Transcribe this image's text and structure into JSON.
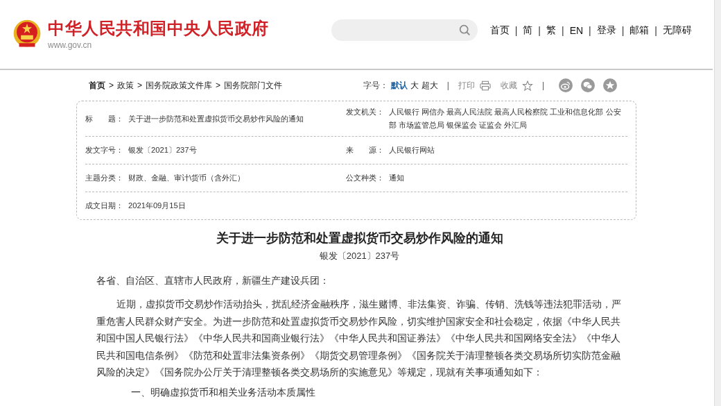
{
  "header": {
    "site_title": "中华人民共和国中央人民政府",
    "site_url": "www.gov.cn",
    "nav_separator": "|",
    "nav_links": [
      "首页",
      "简",
      "繁",
      "EN",
      "登录",
      "邮箱",
      "无障碍"
    ]
  },
  "toolbar": {
    "breadcrumb_separator": ">",
    "breadcrumb": [
      {
        "label": "首页",
        "current_root": true
      },
      {
        "label": "政策",
        "current_root": false
      },
      {
        "label": "国务院政策文件库",
        "current_root": false
      },
      {
        "label": "国务院部门文件",
        "current_root": false
      }
    ],
    "font_size_label": "字号：",
    "font_sizes": [
      {
        "label": "默认",
        "selected": true
      },
      {
        "label": "大",
        "selected": false
      },
      {
        "label": "超大",
        "selected": false
      }
    ],
    "separator": "|",
    "print": "打印",
    "favorite": "收藏"
  },
  "info_rows": [
    [
      {
        "label": "标　　题：",
        "value": "关于进一步防范和处置虚拟货币交易炒作风险的通知"
      },
      {
        "label": "发文机关：",
        "value": "人民银行 网信办 最高人民法院 最高人民检察院 工业和信息化部 公安部 市场监管总局 银保监会 证监会 外汇局"
      }
    ],
    [
      {
        "label": "发文字号：",
        "value": "银发〔2021〕237号"
      },
      {
        "label": "来　　源：",
        "value": "人民银行网站"
      }
    ],
    [
      {
        "label": "主题分类：",
        "value": "财政、金融、审计\\货币（含外汇）"
      },
      {
        "label": "公文种类：",
        "value": "通知"
      }
    ],
    [
      {
        "label": "成文日期：",
        "value": "2021年09月15日"
      }
    ]
  ],
  "article": {
    "title": "关于进一步防范和处置虚拟货币交易炒作风险的通知",
    "doc_number": "银发〔2021〕237号",
    "salutation": "各省、自治区、直辖市人民政府，新疆生产建设兵团：",
    "paragraphs": [
      "近期，虚拟货币交易炒作活动抬头，扰乱经济金融秩序，滋生赌博、非法集资、诈骗、传销、洗钱等违法犯罪活动，严重危害人民群众财产安全。为进一步防范和处置虚拟货币交易炒作风险，切实维护国家安全和社会稳定，依据《中华人民共和国中国人民银行法》《中华人民共和国商业银行法》《中华人民共和国证券法》《中华人民共和国网络安全法》《中华人民共和国电信条例》《防范和处置非法集资条例》《期货交易管理条例》《国务院关于清理整顿各类交易场所切实防范金融风险的决定》《国务院办公厅关于清理整顿各类交易场所的实施意见》等规定，现就有关事项通知如下："
    ],
    "section_heading": "一、明确虚拟货币和相关业务活动本质属性"
  }
}
